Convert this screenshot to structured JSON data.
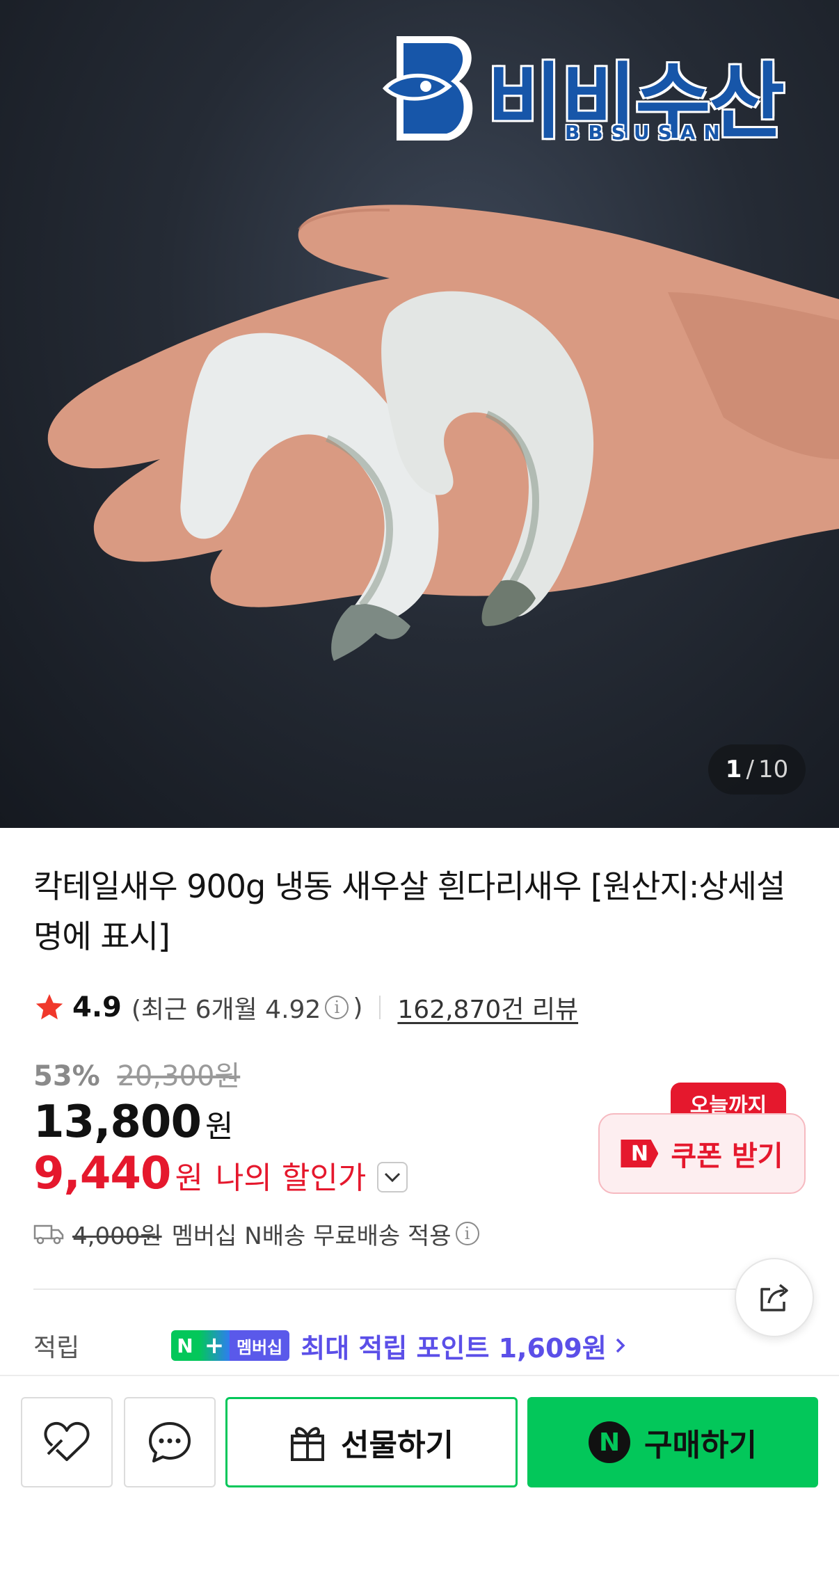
{
  "hero": {
    "image_alt": "shrimp-in-hand-photo",
    "logo_brand_ko": "비비수산",
    "logo_brand_en": "BBSUSAN",
    "counter_current": "1",
    "counter_sep": "/",
    "counter_total": "10"
  },
  "product": {
    "title": "칵테일새우 900g 냉동 새우살 흰다리새우 [원산지:상세설명에 표시]",
    "rating": "4.9",
    "recent_rating_prefix": "(최근 6개월 4.92",
    "recent_rating_suffix": ")",
    "review_count": "162,870건 리뷰"
  },
  "price": {
    "discount_rate": "53%",
    "original_price": "20,300원",
    "sale_price": "13,800",
    "currency": "원",
    "my_price": "9,440",
    "my_currency": "원",
    "my_label": "나의 할인가"
  },
  "coupon": {
    "badge": "오늘까지",
    "n_mark": "N",
    "label": "쿠폰 받기"
  },
  "shipping": {
    "old_fee": "4,000원",
    "text": "멤버십 N배송 무료배송 적용"
  },
  "points": {
    "label": "적립",
    "badge_n": "N",
    "badge_plus": "+",
    "badge_membership": "멤버십",
    "text": "최대 적립 포인트 1,609원"
  },
  "bottom_bar": {
    "gift_label": "선물하기",
    "buy_label": "구매하기",
    "buy_n_mark": "N"
  },
  "colors": {
    "naver_green": "#03c75a",
    "discount_red": "#e5182d",
    "point_purple": "#5b4fe8",
    "brand_blue": "#1756a9"
  },
  "icons": [
    "star-icon",
    "info-icon",
    "chevron-down-icon",
    "truck-icon",
    "share-icon",
    "chevron-right-icon",
    "heart-icon",
    "chat-icon",
    "gift-icon"
  ]
}
